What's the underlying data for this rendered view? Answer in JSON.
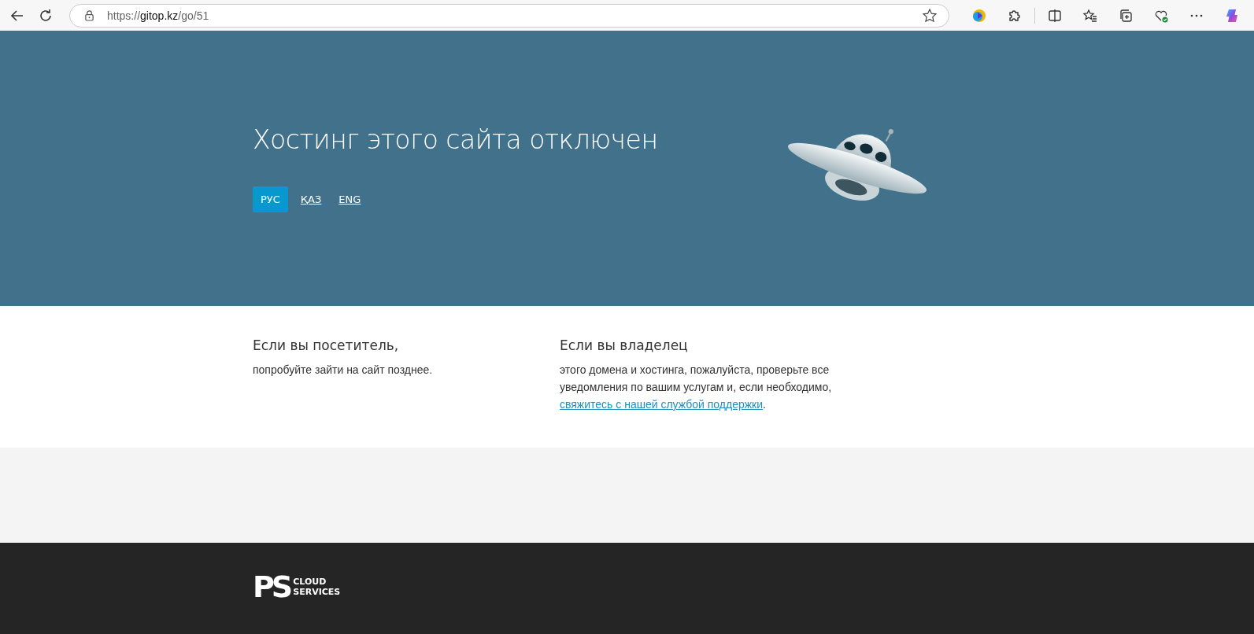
{
  "browser": {
    "url_scheme": "https://",
    "url_host": "gitop.kz",
    "url_path": "/go/51"
  },
  "hero": {
    "title": "Хостинг этого сайта отключен",
    "languages": [
      {
        "label": "РУС",
        "selected": true
      },
      {
        "label": "ҚАЗ",
        "selected": false
      },
      {
        "label": "ENG",
        "selected": false
      }
    ]
  },
  "info": [
    {
      "heading": "Если вы посетитель,",
      "text": "попробуйте зайти на сайт позднее."
    },
    {
      "heading": "Если вы владелец",
      "text": "этого домена и хостинга, пожалуйста, проверьте все уведомления по вашим услугам и, если необходимо,",
      "link": "свяжитесь с нашей службой поддержки",
      "text_after": "."
    }
  ],
  "footer": {
    "logo_mark": "PS",
    "logo_line_1": "CLOUD",
    "logo_line_2": "SERVICES"
  }
}
